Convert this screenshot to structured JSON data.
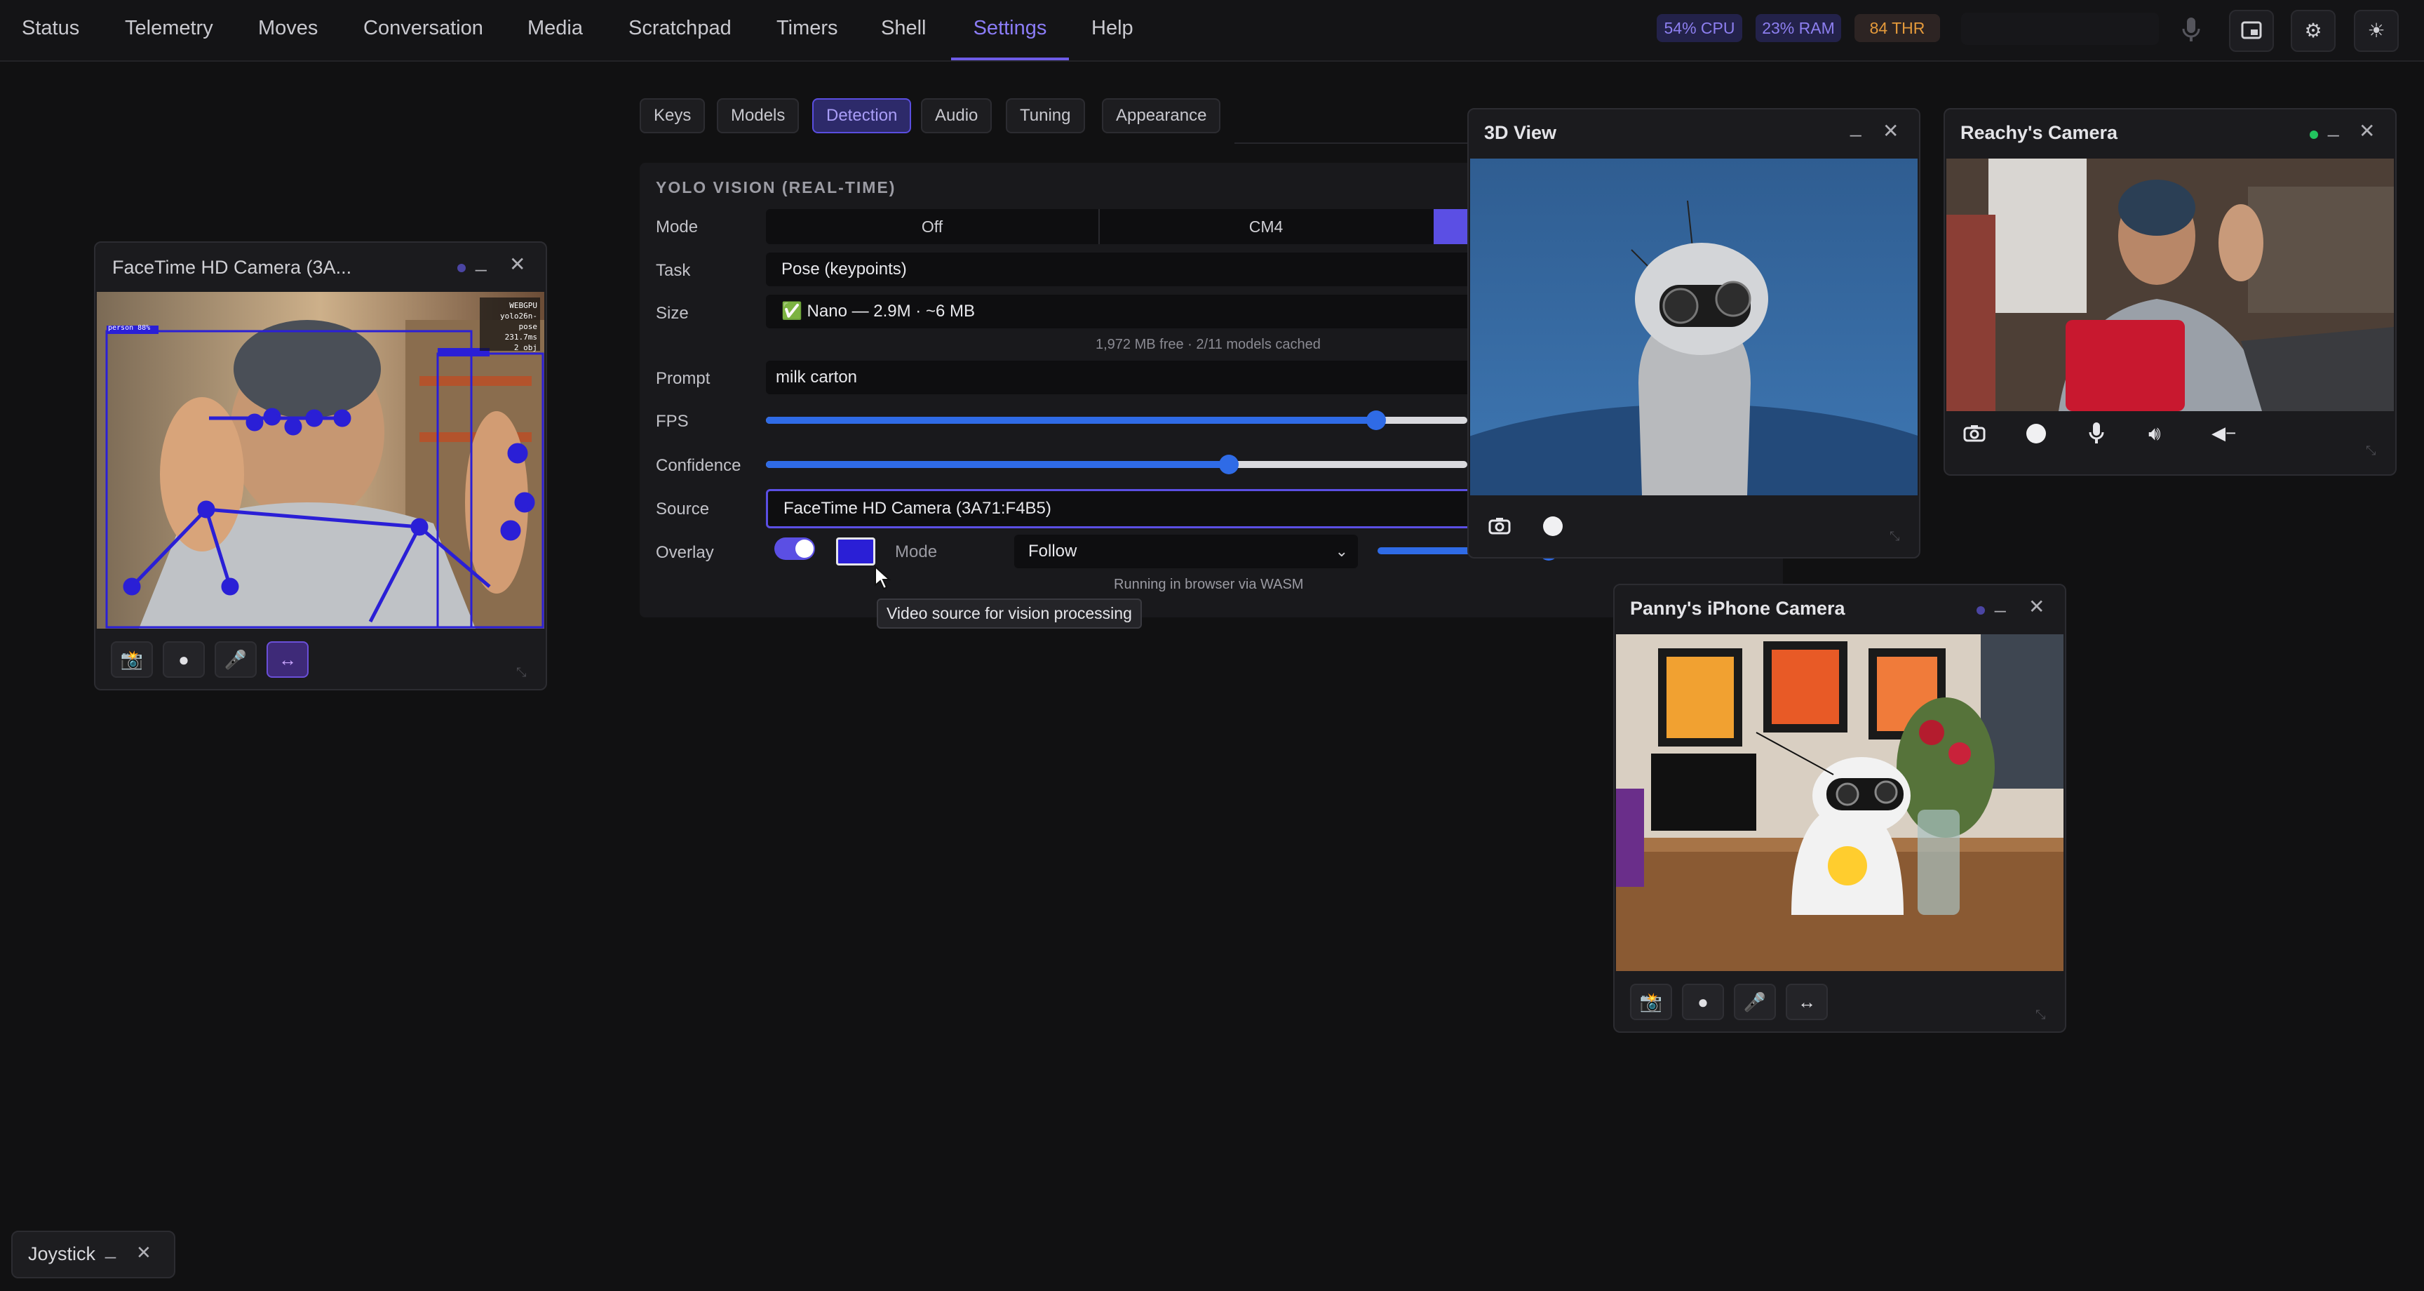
{
  "nav": {
    "tabs": [
      "Status",
      "Telemetry",
      "Moves",
      "Conversation",
      "Media",
      "Scratchpad",
      "Timers",
      "Shell",
      "Settings",
      "Help"
    ],
    "active": "Settings",
    "stats": {
      "cpu": "54% CPU",
      "ram": "23% RAM",
      "thr": "84 THR"
    },
    "icons": [
      "mic-icon",
      "picture-in-picture-icon",
      "gear-icon",
      "sun-icon"
    ]
  },
  "settings": {
    "tabs": [
      "Keys",
      "Models",
      "Detection",
      "Audio",
      "Tuning",
      "Appearance"
    ],
    "active_tab": "Detection",
    "section_title": "YOLO VISION (REAL-TIME)",
    "mode": {
      "label": "Mode",
      "options": [
        "Off",
        "CM4"
      ]
    },
    "task": {
      "label": "Task",
      "value": "Pose (keypoints)"
    },
    "size": {
      "label": "Size",
      "value": "✅ Nano — 2.9M · ~6 MB"
    },
    "cache_note": "1,972 MB free · 2/11 models cached",
    "prompt": {
      "label": "Prompt",
      "value": "milk carton"
    },
    "fps": {
      "label": "FPS",
      "level": 0.87
    },
    "confidence": {
      "label": "Confidence",
      "level": 0.66
    },
    "source": {
      "label": "Source",
      "value": "FaceTime HD Camera (3A71:F4B5)"
    },
    "overlay": {
      "label": "Overlay",
      "mode_label": "Mode",
      "mode_value": "Follow",
      "color": "#2a1fd6"
    },
    "runtime_note": "Running in browser via WASM",
    "tooltip": "Video source for vision processing"
  },
  "windows": {
    "facetime": {
      "title": "FaceTime HD Camera (3A...",
      "hud": [
        "WEBGPU",
        "yolo26n-pose",
        "231.7ms",
        "2 obj"
      ],
      "box_label": "person 88%"
    },
    "view3d": {
      "title": "3D View"
    },
    "reachy": {
      "title": "Reachy's Camera"
    },
    "panny": {
      "title": "Panny's iPhone Camera"
    },
    "joystick": {
      "title": "Joystick"
    }
  }
}
